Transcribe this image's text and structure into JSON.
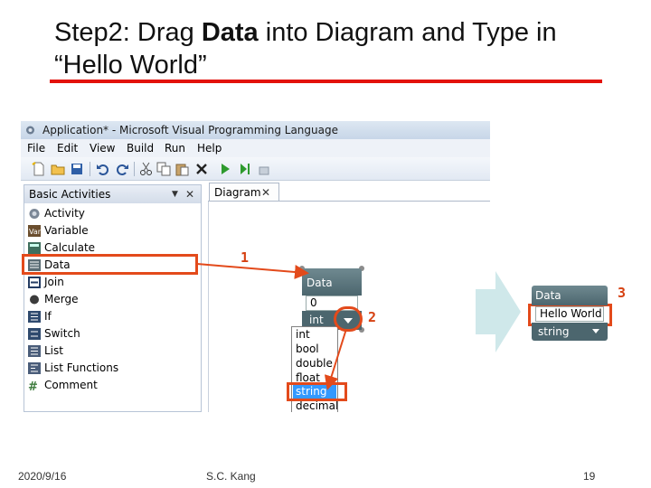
{
  "slide": {
    "title_prefix": "Step2: Drag ",
    "title_bold": "Data",
    "title_suffix": " into Diagram and Type in “Hello World”",
    "footer_date": "2020/9/16",
    "footer_author": "S.C. Kang",
    "footer_page": "19"
  },
  "window": {
    "title": "Application* - Microsoft Visual Programming Language",
    "menu": [
      "File",
      "Edit",
      "View",
      "Build",
      "Run",
      "Help"
    ],
    "toolbar_icons": [
      "new-icon",
      "open-icon",
      "save-icon",
      "undo-icon",
      "redo-icon",
      "cut-icon",
      "copy-icon",
      "paste-icon",
      "delete-icon",
      "run-icon",
      "step-icon",
      "stop-icon"
    ]
  },
  "activities_panel": {
    "title": "Basic Activities",
    "items": [
      {
        "label": "Activity",
        "icon": "activity-icon"
      },
      {
        "label": "Variable",
        "icon": "variable-icon"
      },
      {
        "label": "Calculate",
        "icon": "calculate-icon"
      },
      {
        "label": "Data",
        "icon": "data-icon"
      },
      {
        "label": "Join",
        "icon": "join-icon"
      },
      {
        "label": "Merge",
        "icon": "merge-icon"
      },
      {
        "label": "If",
        "icon": "if-icon"
      },
      {
        "label": "Switch",
        "icon": "switch-icon"
      },
      {
        "label": "List",
        "icon": "list-icon"
      },
      {
        "label": "List Functions",
        "icon": "list-functions-icon"
      },
      {
        "label": "Comment",
        "icon": "comment-icon"
      }
    ]
  },
  "diagram": {
    "tab_label": "Diagram",
    "data_block": {
      "title": "Data",
      "value": "0",
      "type": "int"
    },
    "type_options": [
      "int",
      "bool",
      "double",
      "float",
      "string",
      "decimal"
    ],
    "selected_option": "string"
  },
  "result_block": {
    "title": "Data",
    "value": "Hello World",
    "type": "string"
  },
  "steps": [
    "1",
    "2",
    "3"
  ],
  "colors": {
    "accent_red": "#e3120b",
    "highlight": "#e34a1b",
    "block_header": "#4c666e",
    "selection": "#3399ff"
  }
}
